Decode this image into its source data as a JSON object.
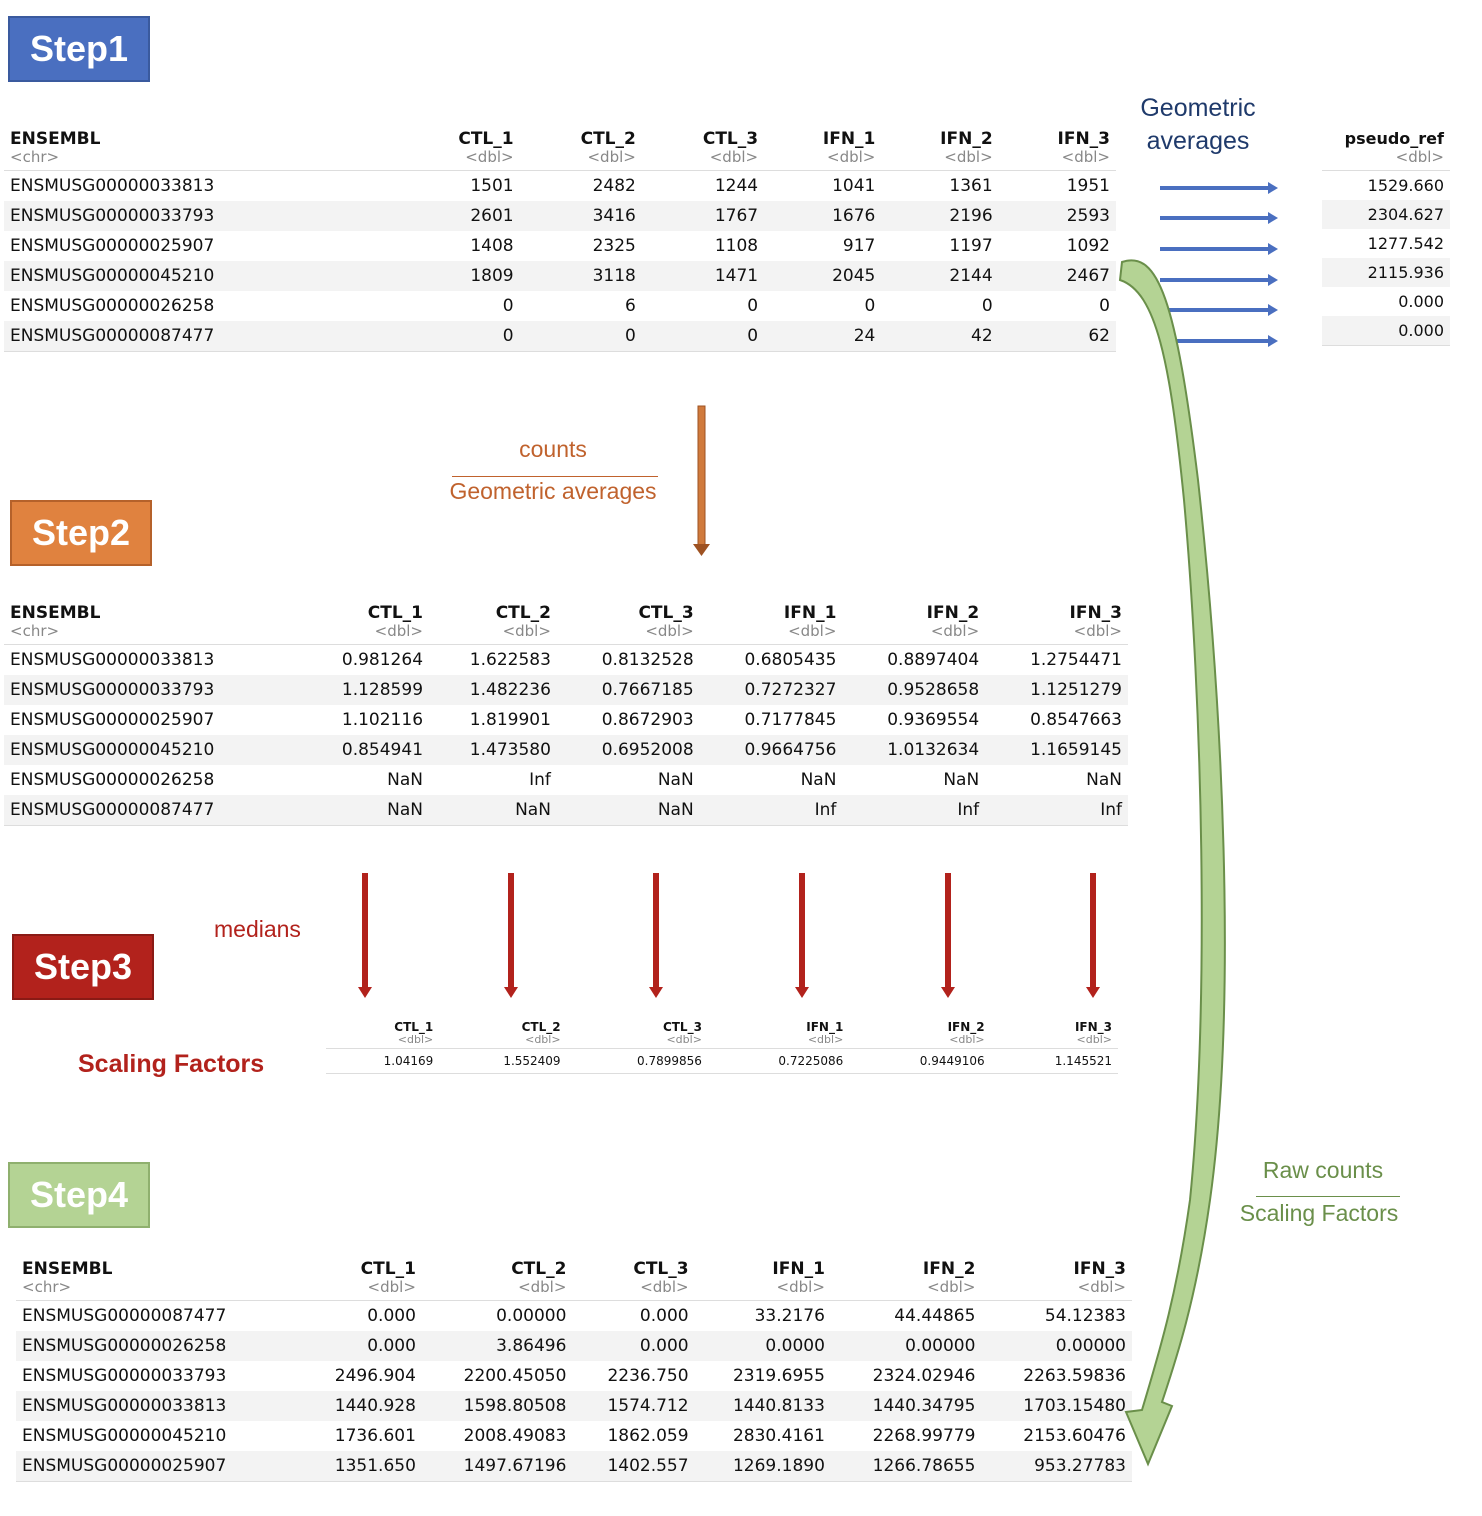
{
  "steps": {
    "step1": "Step1",
    "step2": "Step2",
    "step3": "Step3",
    "step4": "Step4"
  },
  "colors": {
    "step1": "#4a6fc0",
    "step2": "#e0823f",
    "step3": "#b2221c",
    "step4": "#b4d394",
    "blue_arrow": "#4a6fc0",
    "orange": "#c0622d",
    "red": "#b2221c",
    "green": "#6a8f4a",
    "navy": "#1f3a6b"
  },
  "labels": {
    "geo_avg_1": "Geometric",
    "geo_avg_2": "averages",
    "counts": "counts",
    "geometric_averages": "Geometric averages",
    "medians": "medians",
    "scaling_factors": "Scaling Factors",
    "raw_counts": "Raw counts",
    "scaling_factors_2": "Scaling Factors"
  },
  "table1": {
    "columns": [
      {
        "name": "ENSEMBL",
        "type": "<chr>"
      },
      {
        "name": "CTL_1",
        "type": "<dbl>"
      },
      {
        "name": "CTL_2",
        "type": "<dbl>"
      },
      {
        "name": "CTL_3",
        "type": "<dbl>"
      },
      {
        "name": "IFN_1",
        "type": "<dbl>"
      },
      {
        "name": "IFN_2",
        "type": "<dbl>"
      },
      {
        "name": "IFN_3",
        "type": "<dbl>"
      }
    ],
    "rows": [
      [
        "ENSMUSG00000033813",
        "1501",
        "2482",
        "1244",
        "1041",
        "1361",
        "1951"
      ],
      [
        "ENSMUSG00000033793",
        "2601",
        "3416",
        "1767",
        "1676",
        "2196",
        "2593"
      ],
      [
        "ENSMUSG00000025907",
        "1408",
        "2325",
        "1108",
        "917",
        "1197",
        "1092"
      ],
      [
        "ENSMUSG00000045210",
        "1809",
        "3118",
        "1471",
        "2045",
        "2144",
        "2467"
      ],
      [
        "ENSMUSG00000026258",
        "0",
        "6",
        "0",
        "0",
        "0",
        "0"
      ],
      [
        "ENSMUSG00000087477",
        "0",
        "0",
        "0",
        "24",
        "42",
        "62"
      ]
    ]
  },
  "pseudo_ref": {
    "column": {
      "name": "pseudo_ref",
      "type": "<dbl>"
    },
    "values": [
      "1529.660",
      "2304.627",
      "1277.542",
      "2115.936",
      "0.000",
      "0.000"
    ]
  },
  "table2": {
    "columns": [
      {
        "name": "ENSEMBL",
        "type": "<chr>"
      },
      {
        "name": "CTL_1",
        "type": "<dbl>"
      },
      {
        "name": "CTL_2",
        "type": "<dbl>"
      },
      {
        "name": "CTL_3",
        "type": "<dbl>"
      },
      {
        "name": "IFN_1",
        "type": "<dbl>"
      },
      {
        "name": "IFN_2",
        "type": "<dbl>"
      },
      {
        "name": "IFN_3",
        "type": "<dbl>"
      }
    ],
    "rows": [
      [
        "ENSMUSG00000033813",
        "0.981264",
        "1.622583",
        "0.8132528",
        "0.6805435",
        "0.8897404",
        "1.2754471"
      ],
      [
        "ENSMUSG00000033793",
        "1.128599",
        "1.482236",
        "0.7667185",
        "0.7272327",
        "0.9528658",
        "1.1251279"
      ],
      [
        "ENSMUSG00000025907",
        "1.102116",
        "1.819901",
        "0.8672903",
        "0.7177845",
        "0.9369554",
        "0.8547663"
      ],
      [
        "ENSMUSG00000045210",
        "0.854941",
        "1.473580",
        "0.6952008",
        "0.9664756",
        "1.0132634",
        "1.1659145"
      ],
      [
        "ENSMUSG00000026258",
        "NaN",
        "Inf",
        "NaN",
        "NaN",
        "NaN",
        "NaN"
      ],
      [
        "ENSMUSG00000087477",
        "NaN",
        "NaN",
        "NaN",
        "Inf",
        "Inf",
        "Inf"
      ]
    ]
  },
  "table3": {
    "columns": [
      {
        "name": "CTL_1",
        "type": "<dbl>"
      },
      {
        "name": "CTL_2",
        "type": "<dbl>"
      },
      {
        "name": "CTL_3",
        "type": "<dbl>"
      },
      {
        "name": "IFN_1",
        "type": "<dbl>"
      },
      {
        "name": "IFN_2",
        "type": "<dbl>"
      },
      {
        "name": "IFN_3",
        "type": "<dbl>"
      }
    ],
    "rows": [
      [
        "1.04169",
        "1.552409",
        "0.7899856",
        "0.7225086",
        "0.9449106",
        "1.145521"
      ]
    ]
  },
  "table4": {
    "columns": [
      {
        "name": "ENSEMBL",
        "type": "<chr>"
      },
      {
        "name": "CTL_1",
        "type": "<dbl>"
      },
      {
        "name": "CTL_2",
        "type": "<dbl>"
      },
      {
        "name": "CTL_3",
        "type": "<dbl>"
      },
      {
        "name": "IFN_1",
        "type": "<dbl>"
      },
      {
        "name": "IFN_2",
        "type": "<dbl>"
      },
      {
        "name": "IFN_3",
        "type": "<dbl>"
      }
    ],
    "rows": [
      [
        "ENSMUSG00000087477",
        "0.000",
        "0.00000",
        "0.000",
        "33.2176",
        "44.44865",
        "54.12383"
      ],
      [
        "ENSMUSG00000026258",
        "0.000",
        "3.86496",
        "0.000",
        "0.0000",
        "0.00000",
        "0.00000"
      ],
      [
        "ENSMUSG00000033793",
        "2496.904",
        "2200.45050",
        "2236.750",
        "2319.6955",
        "2324.02946",
        "2263.59836"
      ],
      [
        "ENSMUSG00000033813",
        "1440.928",
        "1598.80508",
        "1574.712",
        "1440.8133",
        "1440.34795",
        "1703.15480"
      ],
      [
        "ENSMUSG00000045210",
        "1736.601",
        "2008.49083",
        "1862.059",
        "2830.4161",
        "2268.99779",
        "2153.60476"
      ],
      [
        "ENSMUSG00000025907",
        "1351.650",
        "1497.67196",
        "1402.557",
        "1269.1890",
        "1266.78655",
        "953.27783"
      ]
    ]
  }
}
